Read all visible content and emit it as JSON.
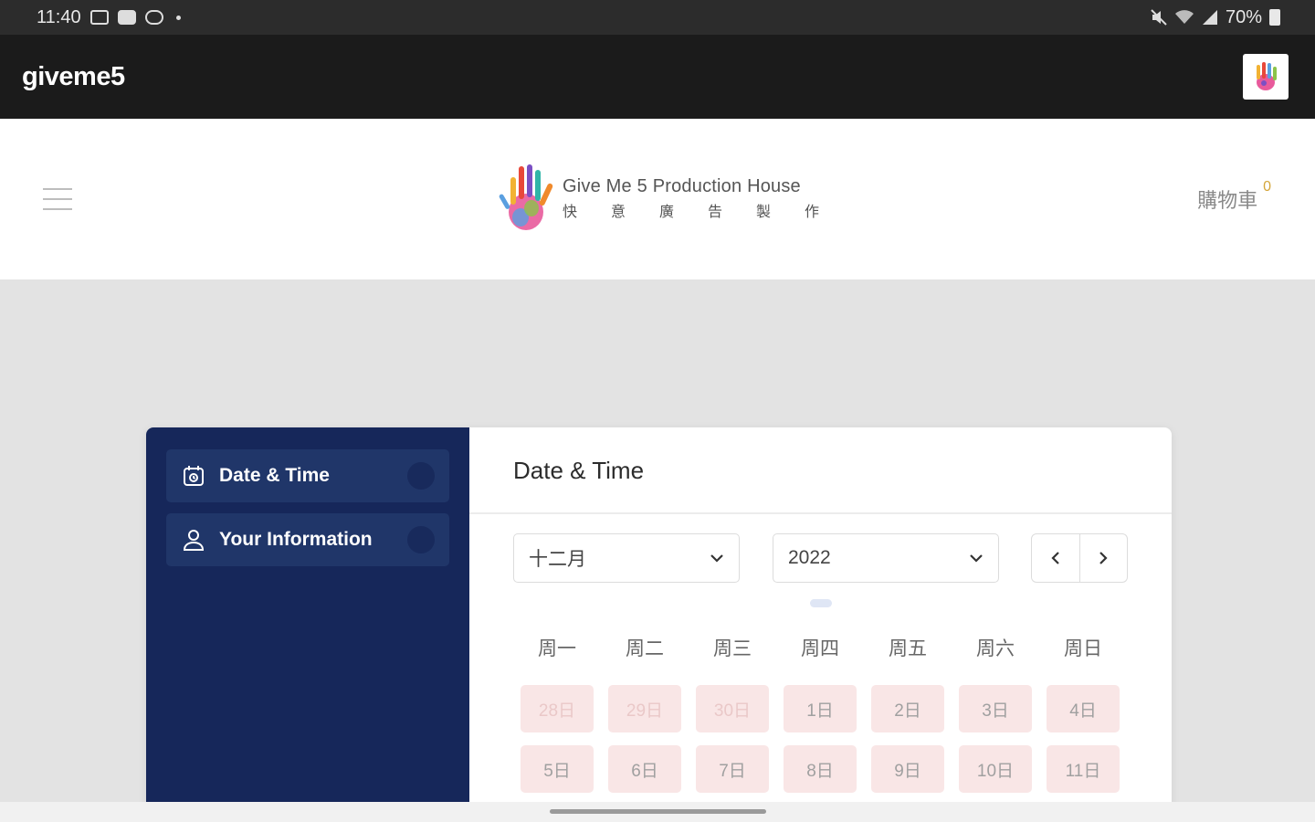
{
  "status_bar": {
    "time": "11:40",
    "battery": "70%",
    "icons": [
      "image-icon",
      "youtube-icon",
      "cloud-icon",
      "mute-icon",
      "wifi-icon",
      "signal-icon",
      "battery-icon"
    ]
  },
  "app_bar": {
    "title": "giveme5",
    "icon": "giveme5-hand-logo-icon"
  },
  "site_header": {
    "logo_en": "Give Me 5 Production House",
    "logo_zh": "快意廣告製作",
    "cart_label": "購物車",
    "cart_count": "0"
  },
  "booking": {
    "steps": [
      {
        "label": "Date & Time",
        "icon": "calendar-clock-icon"
      },
      {
        "label": "Your Information",
        "icon": "user-icon"
      }
    ],
    "title": "Date & Time",
    "month_value": "十二月",
    "year_value": "2022",
    "weekdays": [
      "周一",
      "周二",
      "周三",
      "周四",
      "周五",
      "周六",
      "周日"
    ],
    "days": [
      {
        "label": "28日",
        "muted": true
      },
      {
        "label": "29日",
        "muted": true
      },
      {
        "label": "30日",
        "muted": true
      },
      {
        "label": "1日",
        "muted": false
      },
      {
        "label": "2日",
        "muted": false
      },
      {
        "label": "3日",
        "muted": false
      },
      {
        "label": "4日",
        "muted": false
      },
      {
        "label": "5日",
        "muted": false
      },
      {
        "label": "6日",
        "muted": false
      },
      {
        "label": "7日",
        "muted": false
      },
      {
        "label": "8日",
        "muted": false
      },
      {
        "label": "9日",
        "muted": false
      },
      {
        "label": "10日",
        "muted": false
      },
      {
        "label": "11日",
        "muted": false
      }
    ]
  },
  "colors": {
    "sidebar": "#16275a",
    "step_bg": "#203669",
    "day_bg": "#f9e6e6",
    "cart_count": "#d4a63a"
  }
}
